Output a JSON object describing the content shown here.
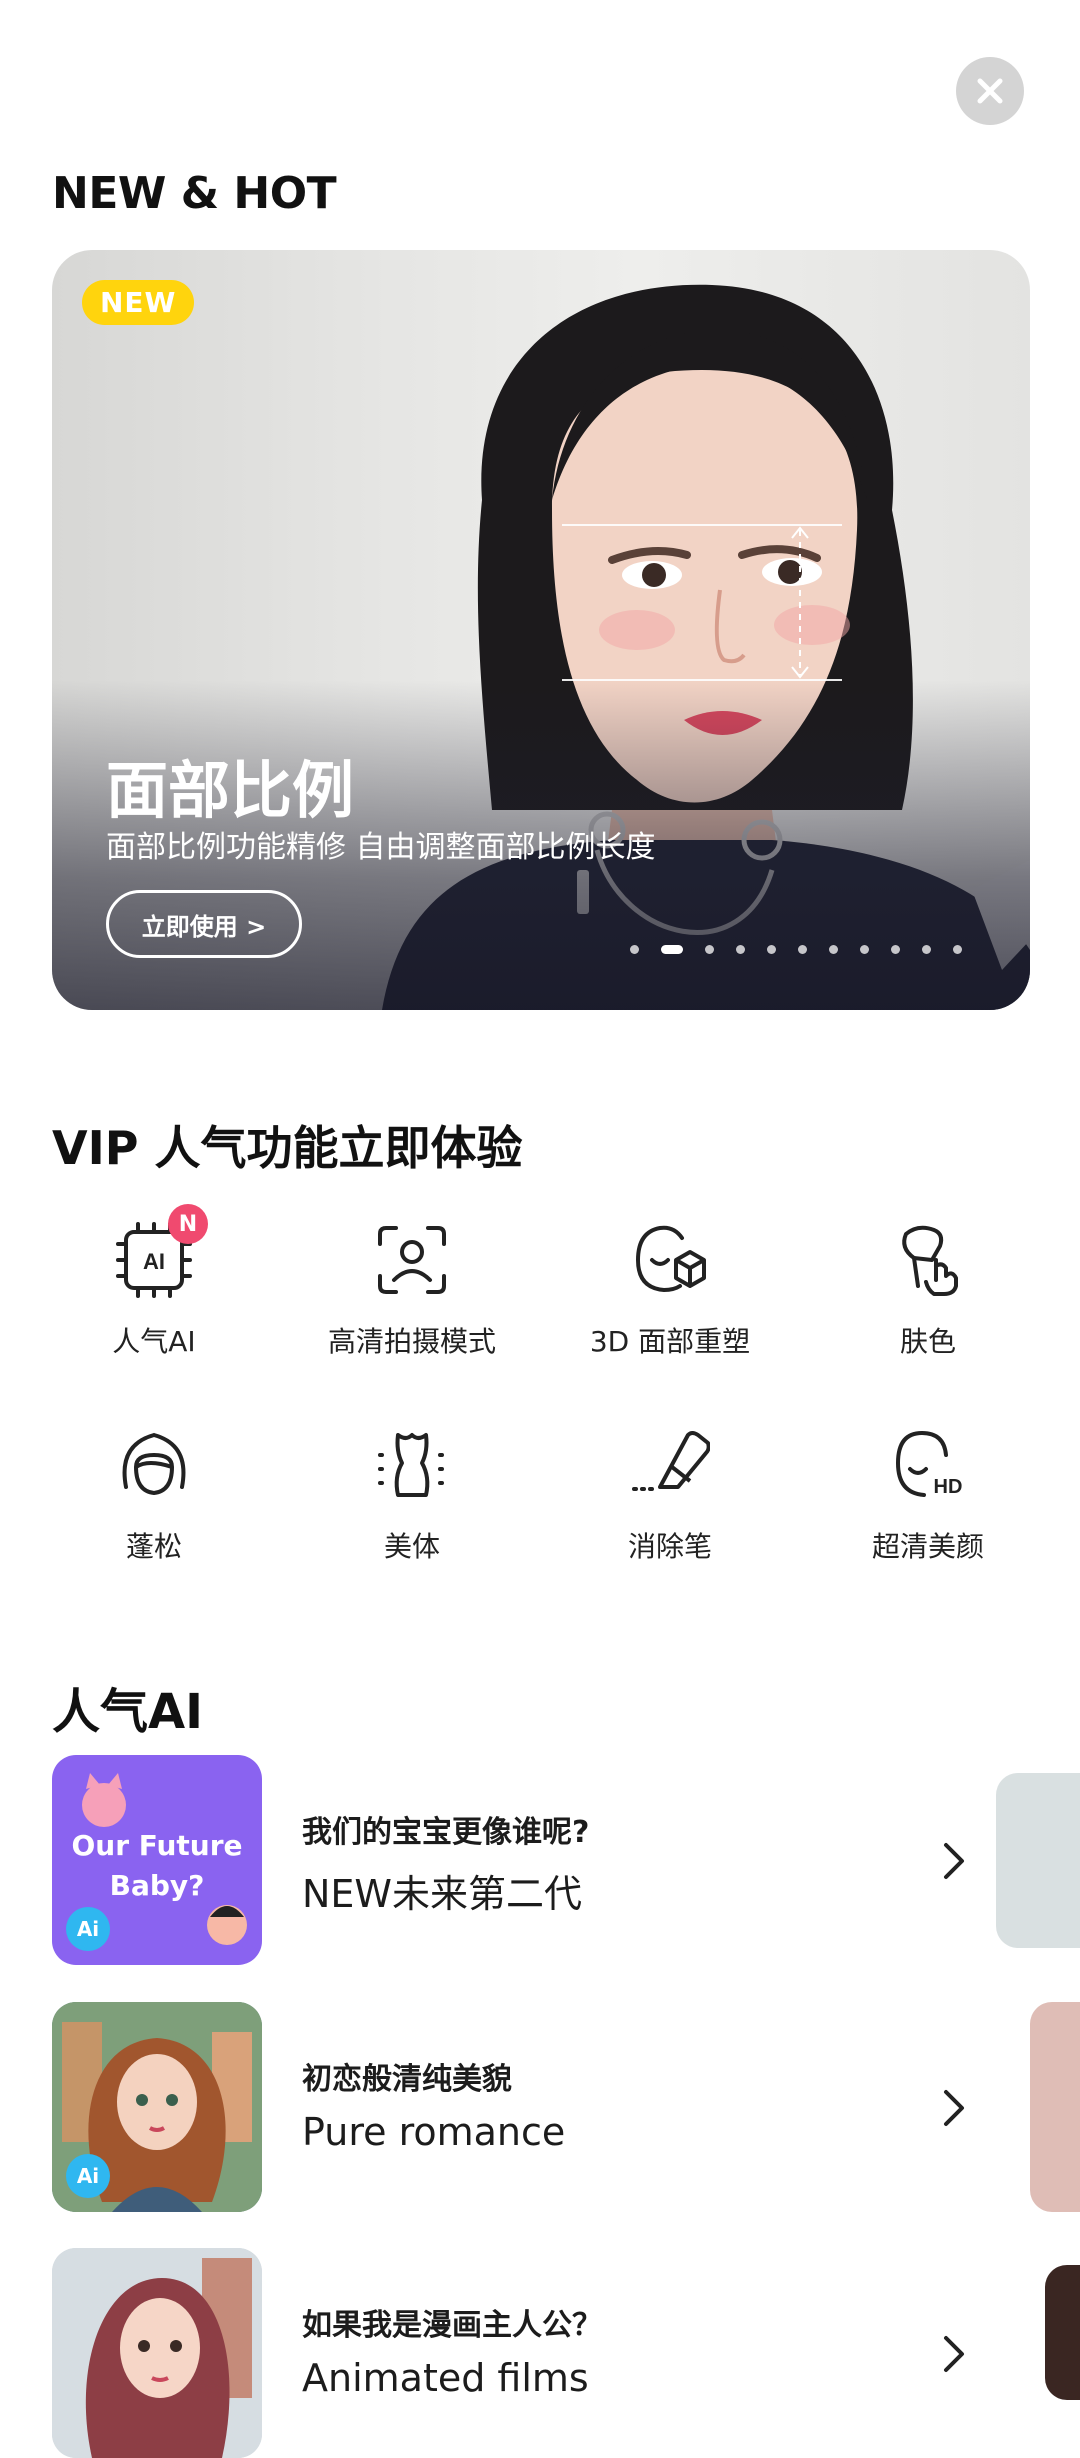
{
  "close": {
    "icon": "close-icon"
  },
  "sections": {
    "new_hot": "NEW & HOT",
    "vip": "VIP 人气功能立即体验",
    "popular_ai": "人气AI"
  },
  "banner": {
    "badge": "NEW",
    "title": "面部比例",
    "subtitle": "面部比例功能精修 自由调整面部比例长度",
    "cta": "立即使用 >",
    "page_count": 11,
    "active_page": 2
  },
  "vip_features": [
    {
      "label": "人气AI",
      "icon": "ai-chip-icon",
      "badge": "N"
    },
    {
      "label": "高清拍摄模式",
      "icon": "hd-camera-face-icon"
    },
    {
      "label": "3D 面部重塑",
      "icon": "3d-face-icon"
    },
    {
      "label": "肤色",
      "icon": "skin-tone-icon"
    },
    {
      "label": "蓬松",
      "icon": "hair-volume-icon"
    },
    {
      "label": "美体",
      "icon": "body-shape-icon"
    },
    {
      "label": "消除笔",
      "icon": "eraser-icon"
    },
    {
      "label": "超清美颜",
      "icon": "hd-beauty-icon"
    }
  ],
  "ai_items": [
    {
      "subtitle": "我们的宝宝更像谁呢?",
      "title": "NEW未来第二代",
      "thumb_text": "Our Future Baby?",
      "badge": "Ai"
    },
    {
      "subtitle": "初恋般清纯美貌",
      "title": "Pure romance",
      "badge": "Ai"
    },
    {
      "subtitle": "如果我是漫画主人公？",
      "title": "Animated films"
    }
  ],
  "colors": {
    "accent_new": "#ffd40d",
    "badge_n": "#f04a6f",
    "ai_badge": "#2fb7f0",
    "thumb_purple": "#8a63f0"
  }
}
